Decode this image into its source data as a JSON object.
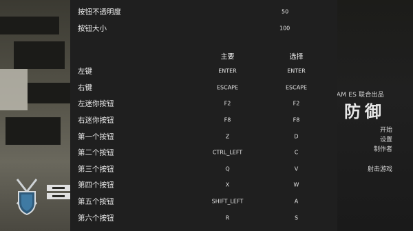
{
  "background": {
    "brand": "ORGAM ES 联合出品",
    "title": "防御",
    "menu": [
      "开始",
      "设置",
      "制作者",
      "射击游戏"
    ]
  },
  "settings": {
    "opacity_label": "按钮不透明度",
    "opacity_value": "50",
    "size_label": "按钮大小",
    "size_value": "100",
    "col_primary": "主要",
    "col_alt": "选择",
    "bindings": [
      {
        "label": "左键",
        "primary": "ENTER",
        "alt": "ENTER"
      },
      {
        "label": "右键",
        "primary": "ESCAPE",
        "alt": "ESCAPE"
      },
      {
        "label": "左迷你按钮",
        "primary": "F2",
        "alt": "F2"
      },
      {
        "label": "右迷你按钮",
        "primary": "F8",
        "alt": "F8"
      },
      {
        "label": "第一个按钮",
        "primary": "Z",
        "alt": "D"
      },
      {
        "label": "第二个按钮",
        "primary": "CTRL_LEFT",
        "alt": "C"
      },
      {
        "label": "第三个按钮",
        "primary": "Q",
        "alt": "V"
      },
      {
        "label": "第四个按钮",
        "primary": "X",
        "alt": "W"
      },
      {
        "label": "第五个按钮",
        "primary": "SHIFT_LEFT",
        "alt": "A"
      },
      {
        "label": "第六个按钮",
        "primary": "R",
        "alt": "S"
      }
    ]
  }
}
